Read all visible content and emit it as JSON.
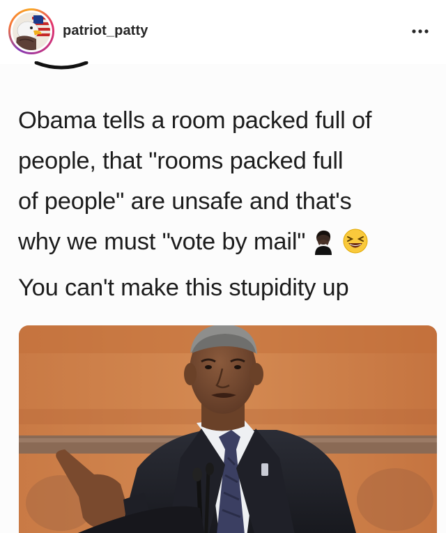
{
  "post": {
    "username": "patriot_patty",
    "avatar_icon": "eagle-flag-avatar",
    "more_icon": "more-horizontal-icon",
    "meme": {
      "lines": [
        "Obama tells a room packed full of",
        "people, that \"rooms packed full",
        "of people\" are unsafe and that's",
        "why we must \"vote by mail\"",
        "You can't make this stupidity up"
      ],
      "emojis": [
        "facepalm-emoji",
        "laughing-emoji"
      ]
    },
    "photo": {
      "icon": "speaker-at-podium-photo"
    }
  }
}
